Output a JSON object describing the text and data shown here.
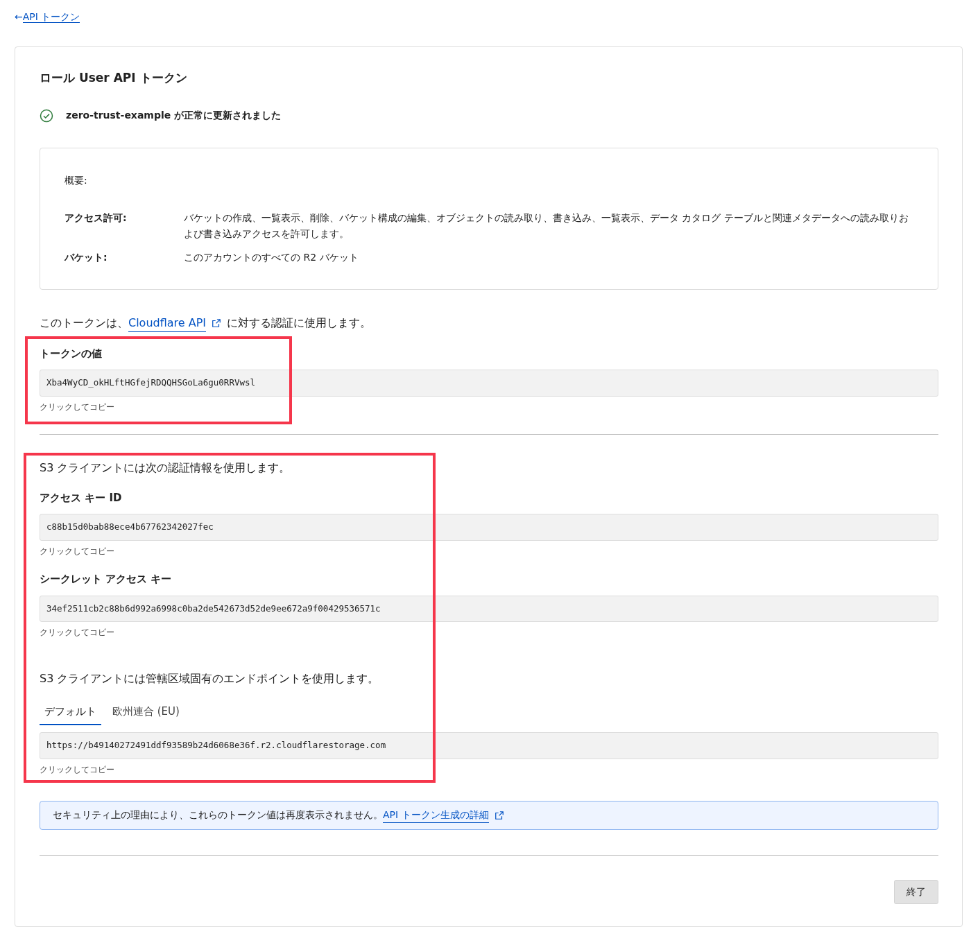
{
  "back_link": {
    "arrow": "←",
    "label": "API トークン"
  },
  "title": "ロール User API トークン",
  "success_message": "zero-trust-example が正常に更新されました",
  "summary": {
    "heading": "概要:",
    "rows": [
      {
        "label": "アクセス許可:",
        "value": "バケットの作成、一覧表示、削除、バケット構成の編集、オブジェクトの読み取り、書き込み、一覧表示、データ カタログ テーブルと関連メタデータへの読み取りおよび書き込みアクセスを許可します。"
      },
      {
        "label": "バケット:",
        "value": "このアカウントのすべての R2 バケット"
      }
    ]
  },
  "usage_text": {
    "before": "このトークンは、",
    "link": "Cloudflare API",
    "after": "に対する認証に使用します。"
  },
  "token_section": {
    "highlighted": true,
    "fields": [
      {
        "label": "トークンの値",
        "value": "Xba4WyCD_okHLftHGfejRDQQHSGoLa6gu0RRVwsl",
        "hint": "クリックしてコピー"
      }
    ]
  },
  "s3_section": {
    "highlighted": true,
    "intro": "S3 クライアントには次の認証情報を使用します。",
    "fields": [
      {
        "label": "アクセス キー ID",
        "value": "c88b15d0bab88ece4b67762342027fec",
        "hint": "クリックしてコピー"
      },
      {
        "label": "シークレット アクセス キー",
        "value": "34ef2511cb2c88b6d992a6998c0ba2de542673d52de9ee672a9f00429536571c",
        "hint": "クリックしてコピー"
      }
    ],
    "endpoint_intro": "S3 クライアントには管轄区域固有のエンドポイントを使用します。",
    "tabs": [
      {
        "label": "デフォルト",
        "selected": true
      },
      {
        "label": "欧州連合 (EU)",
        "selected": false
      }
    ],
    "endpoint": {
      "value": "https://b49140272491ddf93589b24d6068e36f.r2.cloudflarestorage.com",
      "hint": "クリックしてコピー"
    }
  },
  "notice": {
    "text": "セキュリティ上の理由により、これらのトークン値は再度表示されません。",
    "link": "API トークン生成の詳細"
  },
  "finish_button": "終了"
}
